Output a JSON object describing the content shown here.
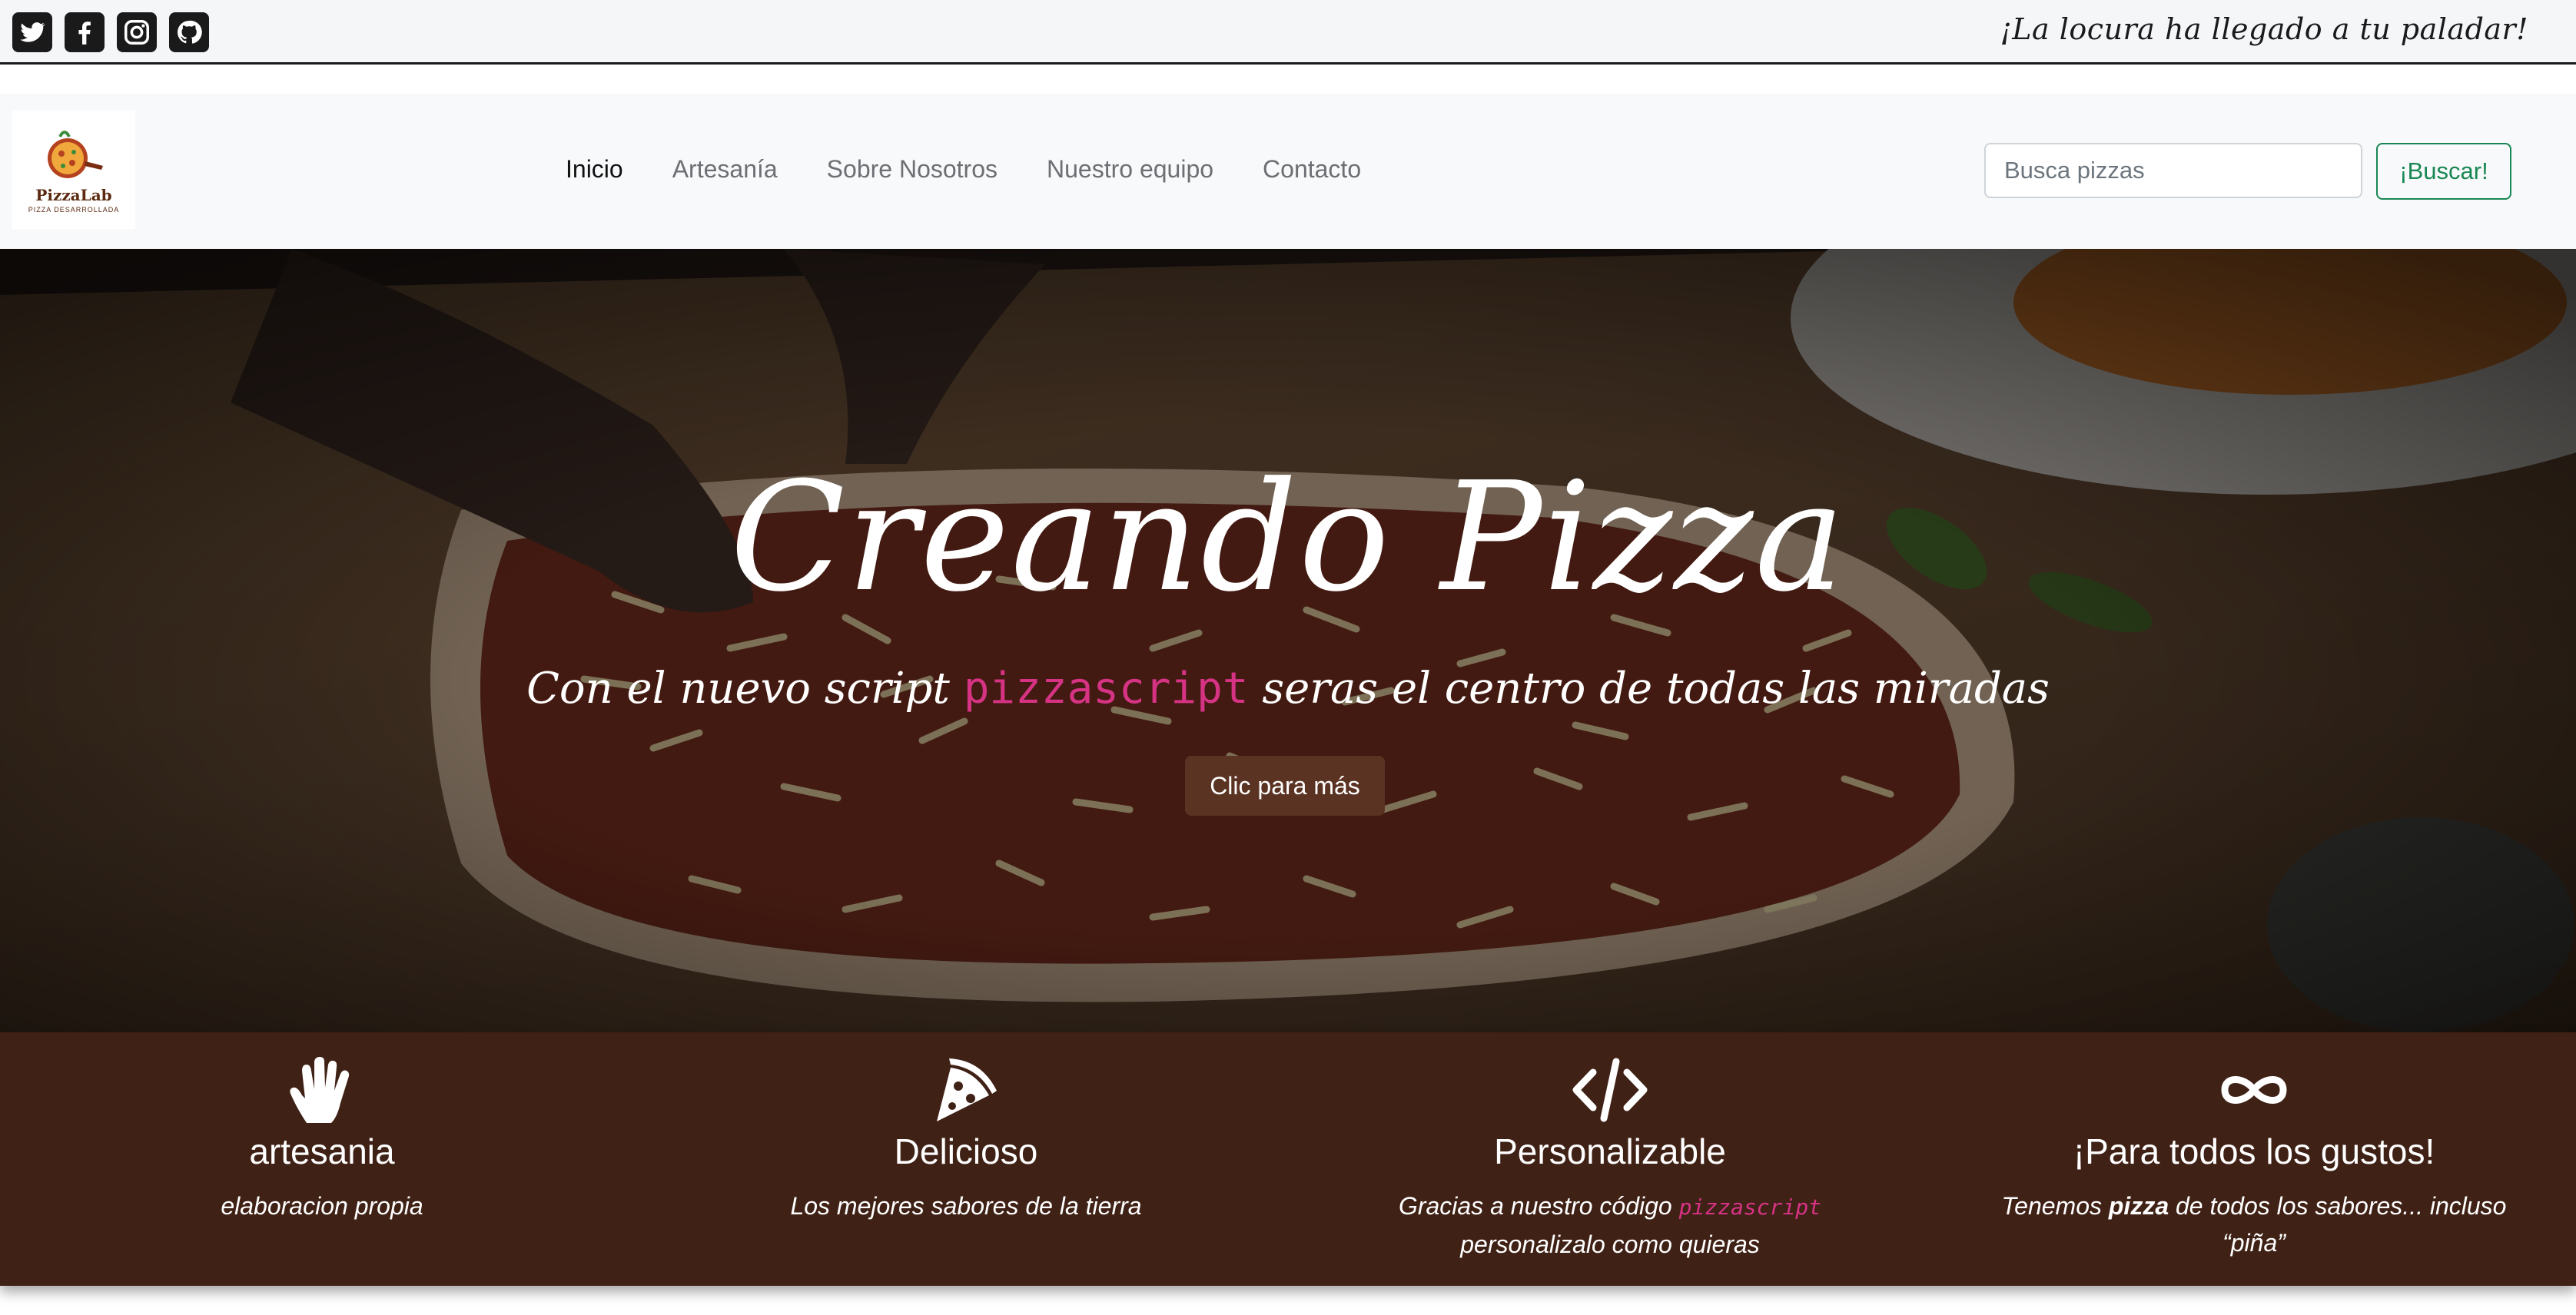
{
  "topbar": {
    "social": [
      {
        "icon": "twitter-icon"
      },
      {
        "icon": "facebook-icon"
      },
      {
        "icon": "instagram-icon"
      },
      {
        "icon": "github-icon"
      }
    ],
    "tagline": "¡La locura ha llegado a tu paladar!"
  },
  "navbar": {
    "logo": {
      "title": "PizzaLab",
      "subtitle": "PIZZA DESARROLLADA"
    },
    "links": [
      "Inicio",
      "Artesanía",
      "Sobre Nosotros",
      "Nuestro equipo",
      "Contacto"
    ],
    "search_placeholder": "Busca pizzas",
    "search_value": "",
    "search_button": "¡Buscar!"
  },
  "hero": {
    "title": "Creando Pizza",
    "subtitle_before": "Con el nuevo script ",
    "subtitle_code": "pizzascript",
    "subtitle_after": " seras el centro de todas las miradas",
    "button": "Clic para más"
  },
  "features": [
    {
      "icon": "hand-icon",
      "title": "artesania",
      "desc": "elaboracion propia"
    },
    {
      "icon": "pizza-slice-icon",
      "title": "Delicioso",
      "desc": "Los mejores sabores de la tierra"
    },
    {
      "icon": "code-icon",
      "title": "Personalizable",
      "desc_before": "Gracias a nuestro código ",
      "desc_code": "pizzascript",
      "desc_after": " personalizalo como quieras"
    },
    {
      "icon": "infinity-icon",
      "title": "¡Para todos los gustos!",
      "desc_before": "Tenemos ",
      "desc_bold": "pizza",
      "desc_after": " de todos los sabores... incluso “piña”"
    }
  ],
  "colors": {
    "accent_green": "#198754",
    "code_pink": "#d63384",
    "features_bg": "#402116",
    "hero_button": "#5b3323"
  }
}
